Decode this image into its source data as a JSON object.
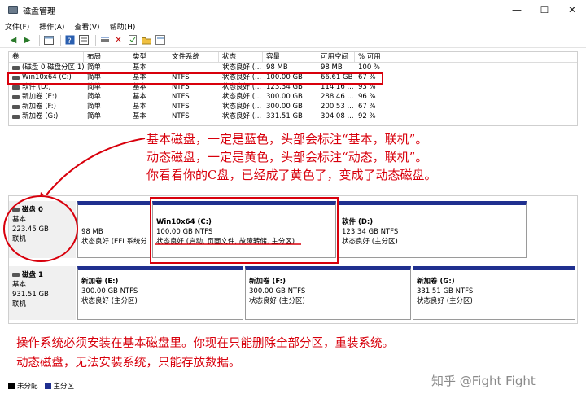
{
  "window": {
    "title": "磁盘管理",
    "min": "—",
    "max": "☐",
    "close": "✕"
  },
  "menu": [
    "文件(F)",
    "操作(A)",
    "查看(V)",
    "帮助(H)"
  ],
  "volume_table": {
    "headers": [
      "卷",
      "布局",
      "类型",
      "文件系统",
      "状态",
      "容量",
      "可用空间",
      "% 可用"
    ],
    "rows": [
      [
        "(磁盘 0 磁盘分区 1)",
        "简单",
        "基本",
        "",
        "状态良好 (...",
        "98 MB",
        "98 MB",
        "100 %"
      ],
      [
        "Win10x64 (C:)",
        "简单",
        "基本",
        "NTFS",
        "状态良好 (...",
        "100.00 GB",
        "66.61 GB",
        "67 %"
      ],
      [
        "软件 (D:)",
        "简单",
        "基本",
        "NTFS",
        "状态良好 (...",
        "123.34 GB",
        "114.16 ...",
        "93 %"
      ],
      [
        "新加卷 (E:)",
        "简单",
        "基本",
        "NTFS",
        "状态良好 (...",
        "300.00 GB",
        "288.46 ...",
        "96 %"
      ],
      [
        "新加卷 (F:)",
        "简单",
        "基本",
        "NTFS",
        "状态良好 (...",
        "300.00 GB",
        "200.53 ...",
        "67 %"
      ],
      [
        "新加卷 (G:)",
        "简单",
        "基本",
        "NTFS",
        "状态良好 (...",
        "331.51 GB",
        "304.08 ...",
        "92 %"
      ]
    ]
  },
  "annotation_top": [
    "基本磁盘，一定是蓝色，头部会标注“基本，联机”。",
    "动态磁盘，一定是黄色，头部会标注“动态，联机”。",
    "你看看你的C盘，已经成了黄色了，变成了动态磁盘。"
  ],
  "disk0": {
    "name": "磁盘 0",
    "type": "基本",
    "size": "223.45 GB",
    "status": "联机",
    "partitions": [
      {
        "name": "",
        "size": "98 MB",
        "status": "状态良好 (EFI 系统分"
      },
      {
        "name": "Win10x64 (C:)",
        "size": "100.00 GB NTFS",
        "status": "状态良好 (启动, 页面文件, 故障转储, 主分区)"
      },
      {
        "name": "软件 (D:)",
        "size": "123.34 GB NTFS",
        "status": "状态良好 (主分区)"
      }
    ]
  },
  "disk1": {
    "name": "磁盘 1",
    "type": "基本",
    "size": "931.51 GB",
    "status": "联机",
    "partitions": [
      {
        "name": "新加卷 (E:)",
        "size": "300.00 GB NTFS",
        "status": "状态良好 (主分区)"
      },
      {
        "name": "新加卷 (F:)",
        "size": "300.00 GB NTFS",
        "status": "状态良好 (主分区)"
      },
      {
        "name": "新加卷 (G:)",
        "size": "331.51 GB NTFS",
        "status": "状态良好 (主分区)"
      }
    ]
  },
  "annotation_bottom": [
    "操作系统必须安装在基本磁盘里。你现在只能删除全部分区，重装系统。",
    "动态磁盘，无法安装系统，只能存放数据。"
  ],
  "legend": {
    "unallocated": "未分配",
    "primary": "主分区"
  },
  "watermark": "知乎 @Fight Fight",
  "colors": {
    "primary_partition": "#1f2f8f",
    "annotation_red": "#d8000c"
  },
  "icons": [
    "back-icon",
    "forward-icon",
    "console-icon",
    "help-icon",
    "connect-icon",
    "delete-icon",
    "properties-icon",
    "folder-icon",
    "list-icon"
  ]
}
